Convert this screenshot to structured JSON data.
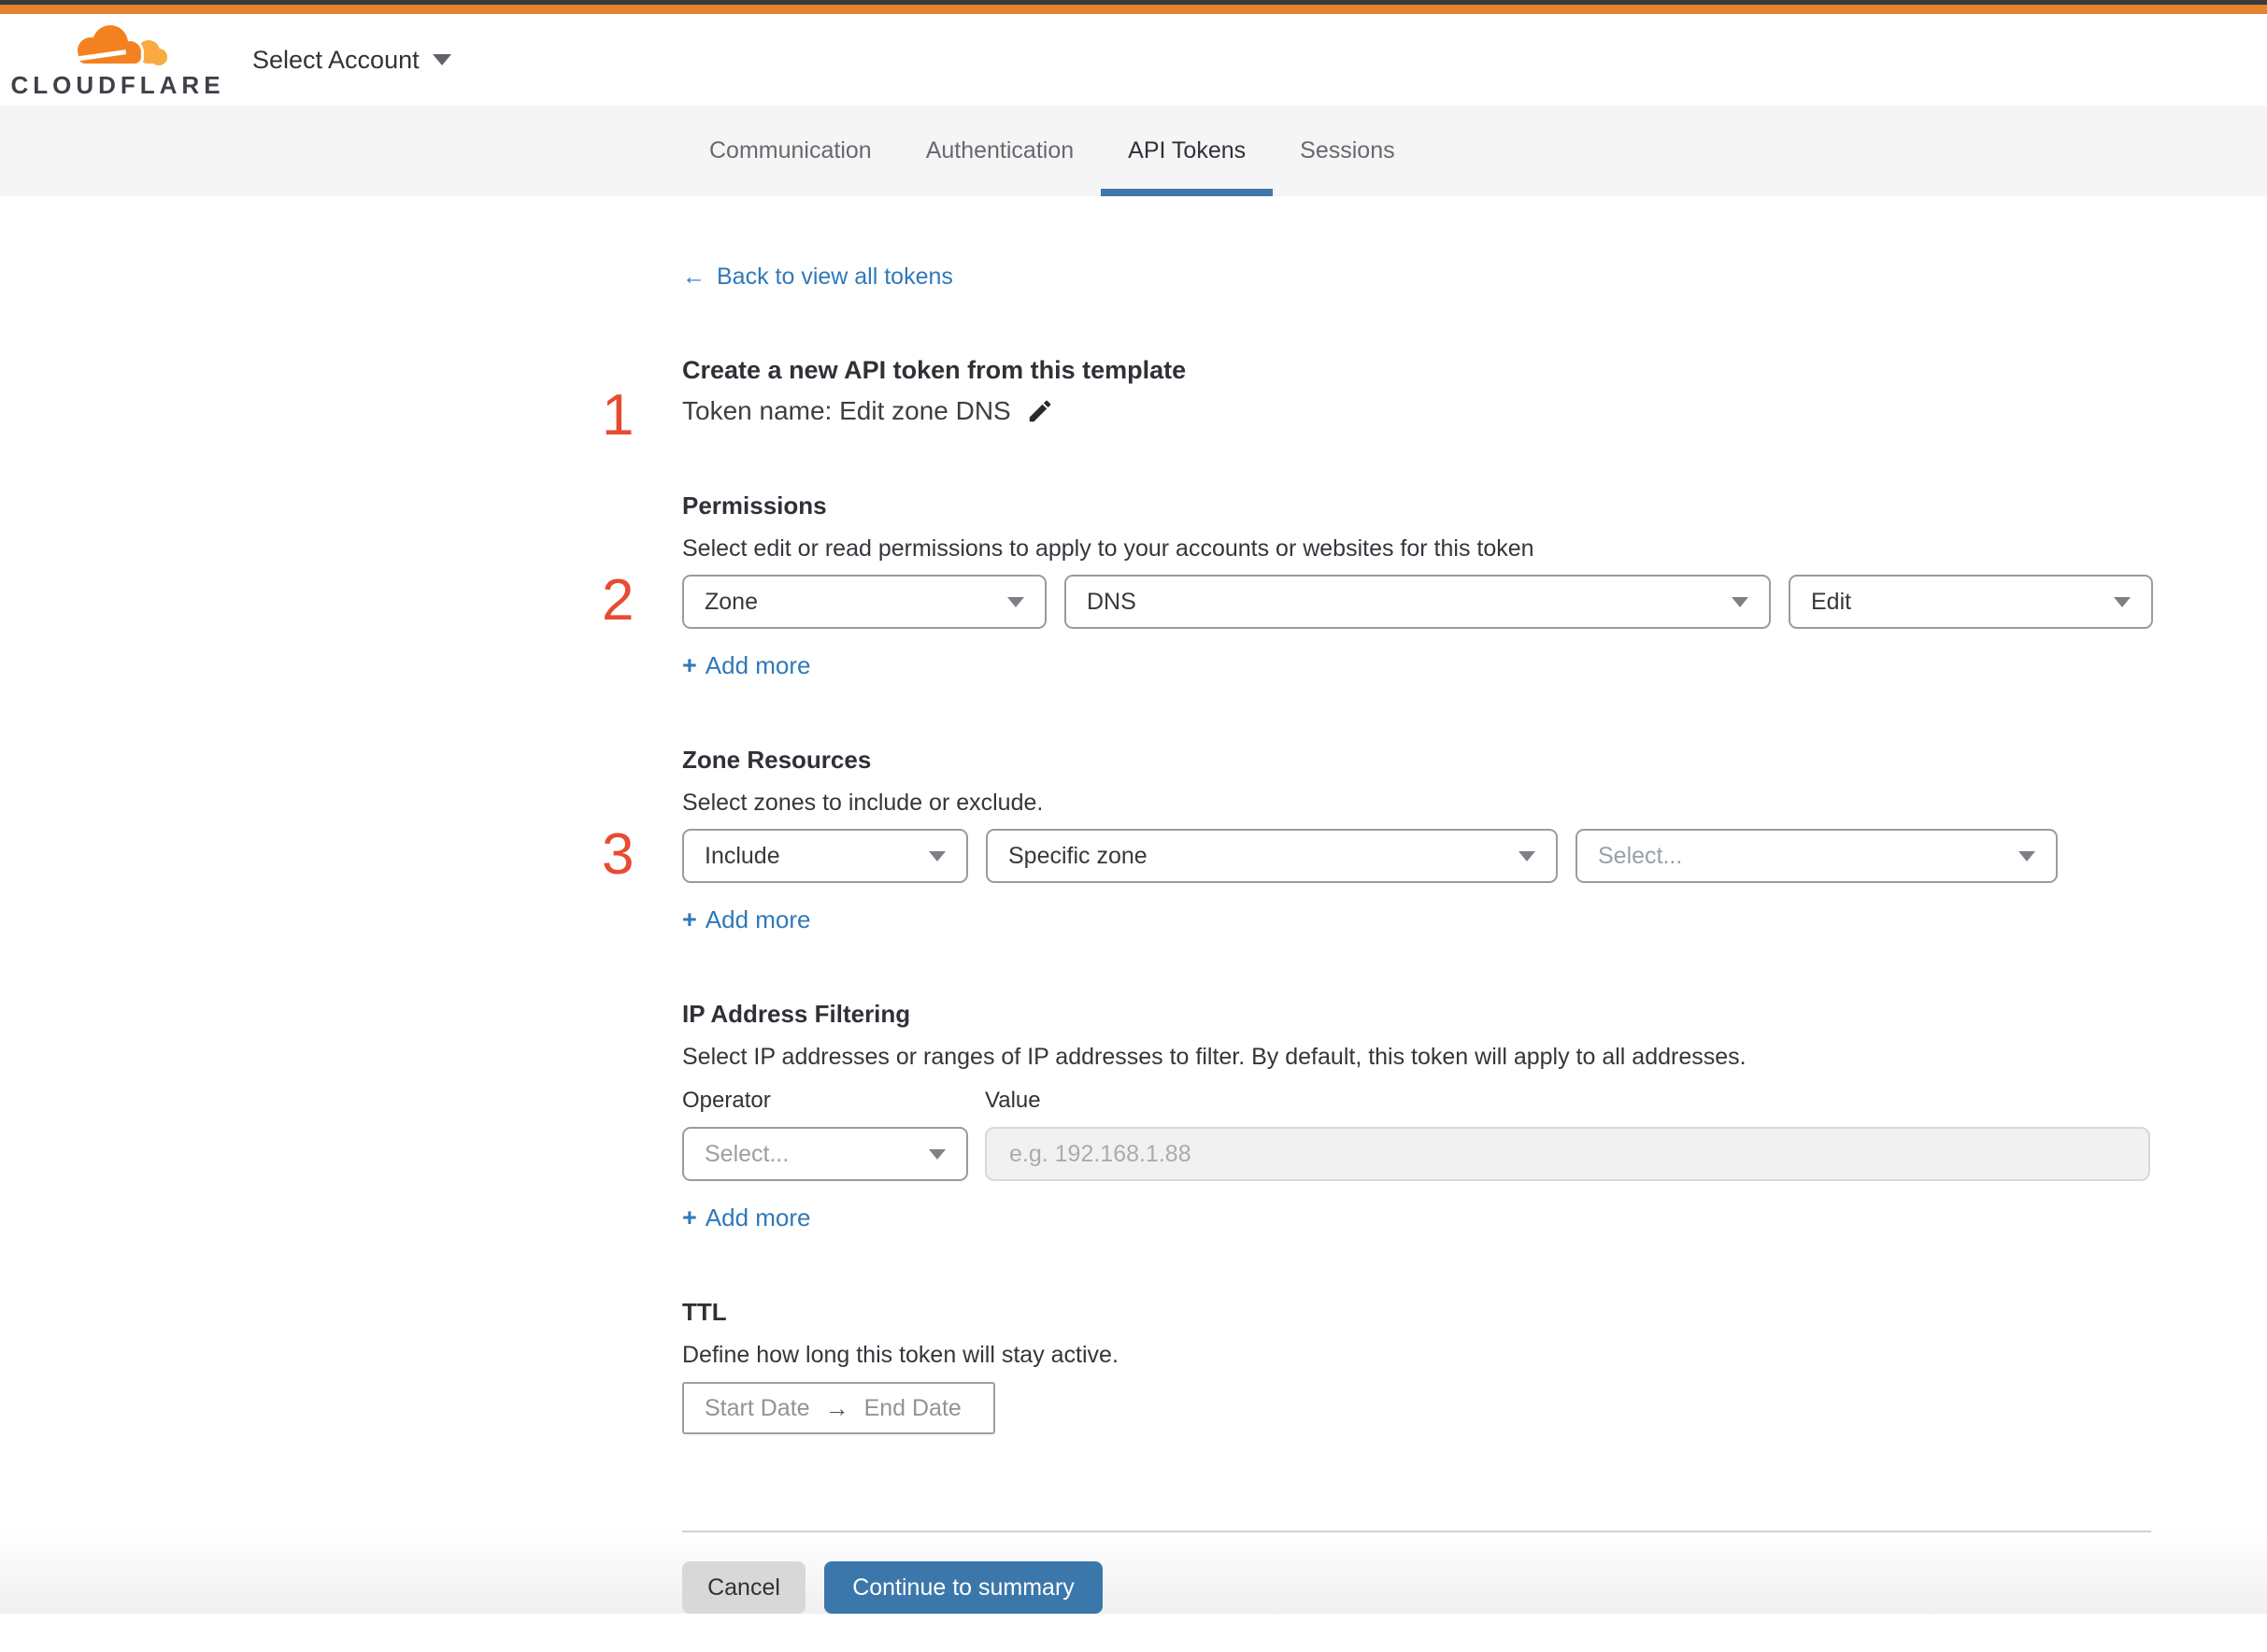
{
  "header": {
    "brand": "CLOUDFLARE",
    "account_selector": "Select Account"
  },
  "tabs": {
    "communication": "Communication",
    "authentication": "Authentication",
    "api_tokens": "API Tokens",
    "sessions": "Sessions"
  },
  "back_link": {
    "arrow": "←",
    "label": "Back to view all tokens"
  },
  "step1": {
    "number": "1",
    "title": "Create a new API token from this template",
    "token_name_line": "Token name: Edit zone DNS"
  },
  "step2": {
    "number": "2",
    "title": "Permissions",
    "subtitle": "Select edit or read permissions to apply to your accounts or websites for this token",
    "scope": "Zone",
    "permission_group": "DNS",
    "access_level": "Edit",
    "add_more": "Add more"
  },
  "step3": {
    "number": "3",
    "title": "Zone Resources",
    "subtitle": "Select zones to include or exclude.",
    "operator": "Include",
    "resource_type": "Specific zone",
    "resource_placeholder": "Select...",
    "add_more": "Add more"
  },
  "ip_filtering": {
    "title": "IP Address Filtering",
    "subtitle": "Select IP addresses or ranges of IP addresses to filter. By default, this token will apply to all addresses.",
    "operator_label": "Operator",
    "value_label": "Value",
    "operator_placeholder": "Select...",
    "value_placeholder": "e.g. 192.168.1.88",
    "add_more": "Add more"
  },
  "ttl": {
    "title": "TTL",
    "subtitle": "Define how long this token will stay active.",
    "start_date": "Start Date",
    "range_arrow": "→",
    "end_date": "End Date"
  },
  "footer": {
    "cancel": "Cancel",
    "continue": "Continue to summary"
  },
  "icons": {
    "plus": "+"
  },
  "colors": {
    "topbar_orange": "#e5822e",
    "link_blue": "#3079b8",
    "step_number_red": "#e84b31",
    "tab_underline_blue": "#4076aa",
    "continue_button_blue": "#3b77aa",
    "cloud_orange": "#f48120",
    "cloud_light_orange": "#f9ab41"
  }
}
